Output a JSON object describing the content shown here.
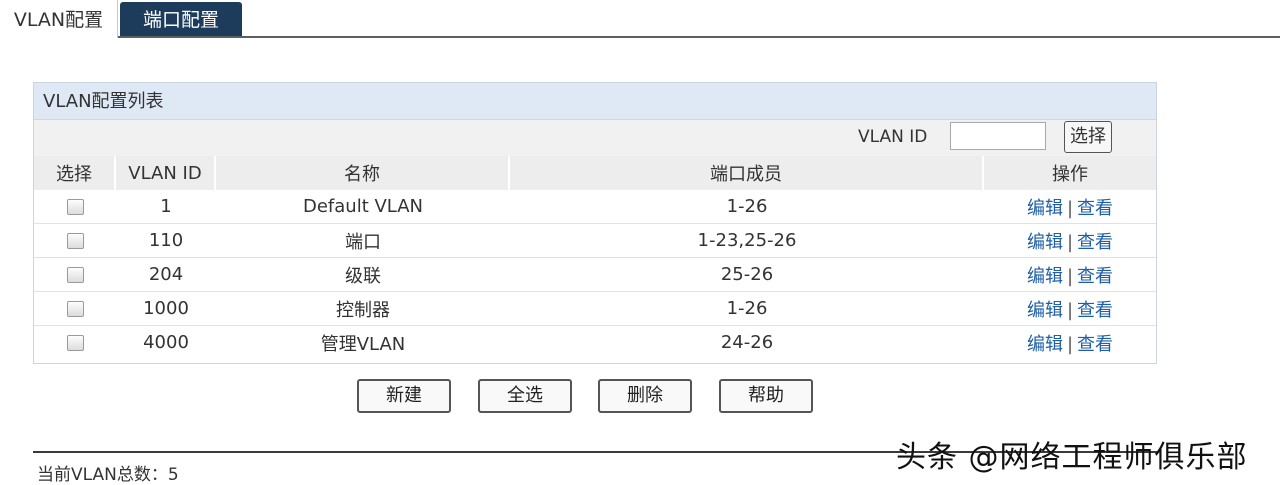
{
  "tabs": [
    {
      "label": "VLAN配置",
      "active": true
    },
    {
      "label": "端口配置",
      "active": false
    }
  ],
  "panel": {
    "title": "VLAN配置列表",
    "search_label": "VLAN ID",
    "search_value": "",
    "search_button": "选择"
  },
  "table": {
    "headers": [
      "选择",
      "VLAN ID",
      "名称",
      "端口成员",
      "操作"
    ],
    "rows": [
      {
        "vlan_id": "1",
        "name": "Default VLAN",
        "ports": "1-26",
        "edit": "编辑",
        "sep": "|",
        "view": "查看"
      },
      {
        "vlan_id": "110",
        "name": "端口",
        "ports": "1-23,25-26",
        "edit": "编辑",
        "sep": "|",
        "view": "查看"
      },
      {
        "vlan_id": "204",
        "name": "级联",
        "ports": "25-26",
        "edit": "编辑",
        "sep": "|",
        "view": "查看"
      },
      {
        "vlan_id": "1000",
        "name": "控制器",
        "ports": "1-26",
        "edit": "编辑",
        "sep": "|",
        "view": "查看"
      },
      {
        "vlan_id": "4000",
        "name": "管理VLAN",
        "ports": "24-26",
        "edit": "编辑",
        "sep": "|",
        "view": "查看"
      }
    ]
  },
  "actions": {
    "new": "新建",
    "select_all": "全选",
    "delete": "删除",
    "help": "帮助"
  },
  "footer": {
    "total_text": "当前VLAN总数：5"
  },
  "watermark": "头条 @网络工程师俱乐部",
  "colors": {
    "tab_active_bg": "#ffffff",
    "tab_inactive_bg": "#1d3c5b",
    "panel_header_bg": "#dfe9f5",
    "link": "#1f5fa8"
  }
}
